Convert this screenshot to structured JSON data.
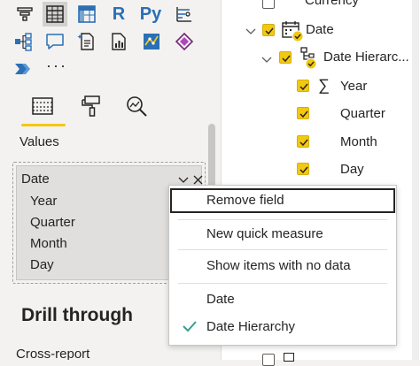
{
  "colors": {
    "accent_yellow": "#f2c811",
    "check_green": "#3a9e8e",
    "pane_bg": "#f3f2f1",
    "blue_icon": "#2b6fb6"
  },
  "visualizations": {
    "icon_row1": [
      {
        "icon": "funnel-chart-icon"
      },
      {
        "icon": "table-icon",
        "selected": true
      },
      {
        "icon": "matrix-icon"
      },
      {
        "icon": "r-visual-icon",
        "text": "R"
      },
      {
        "icon": "python-visual-icon",
        "text": "Py"
      },
      {
        "icon": "key-influencers-icon"
      }
    ],
    "icon_row2": [
      {
        "icon": "decomposition-tree-icon"
      },
      {
        "icon": "qa-icon"
      },
      {
        "icon": "smart-narrative-icon"
      },
      {
        "icon": "paginated-report-icon"
      },
      {
        "icon": "arcgis-map-icon"
      },
      {
        "icon": "power-apps-icon"
      }
    ],
    "icon_row3": [
      {
        "icon": "power-automate-icon"
      }
    ],
    "more_label": "···",
    "sub_tabs": [
      "fields-tab-icon",
      "format-paintbrush-icon",
      "analytics-magnifier-icon"
    ],
    "values_label": "Values",
    "field_chip": {
      "title": "Date",
      "levels": [
        "Year",
        "Quarter",
        "Month",
        "Day"
      ]
    },
    "drill_through_label": "Drill through",
    "cross_report_label": "Cross-report"
  },
  "fields": {
    "currency_label": "Currency",
    "date_label": "Date",
    "hierarchy_label": "Date Hierarc...",
    "items": [
      {
        "label": "Year",
        "checked": true,
        "sigma": true
      },
      {
        "label": "Quarter",
        "checked": true
      },
      {
        "label": "Month",
        "checked": true
      },
      {
        "label": "Day",
        "checked": true
      }
    ]
  },
  "context_menu": {
    "items": [
      {
        "label": "Remove field"
      },
      {
        "label": "New quick measure"
      },
      {
        "label": "Show items with no data"
      },
      {
        "label": "Date"
      },
      {
        "label": "Date Hierarchy",
        "checked": true
      }
    ]
  }
}
